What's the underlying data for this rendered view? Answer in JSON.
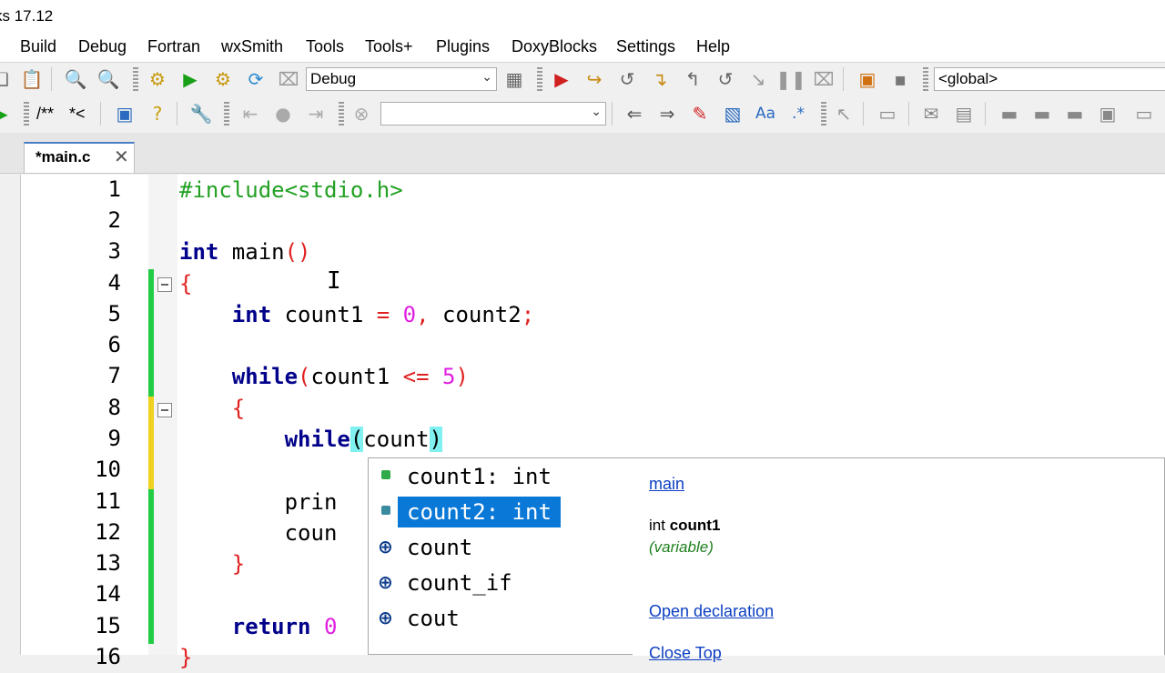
{
  "window": {
    "title": "ks 17.12"
  },
  "menu": [
    "Build",
    "Debug",
    "Fortran",
    "wxSmith",
    "Tools",
    "Tools+",
    "Plugins",
    "DoxyBlocks",
    "Settings",
    "Help"
  ],
  "toolbar1": {
    "build_target": "Debug",
    "scope": "<global>"
  },
  "toolbar2": {
    "comment_block": "/**",
    "comment_line": "*<",
    "search_value": ""
  },
  "editor": {
    "tab_label": "*main.c",
    "line_numbers": [
      "1",
      "2",
      "3",
      "4",
      "5",
      "6",
      "7",
      "8",
      "9",
      "10",
      "11",
      "12",
      "13",
      "14",
      "15",
      "16"
    ],
    "lines": [
      "#include<stdio.h>",
      "",
      "int main()",
      "{",
      "    int count1 = 0, count2;",
      "",
      "    while(count1 <= 5)",
      "    {",
      "        while(count)",
      "",
      "        prin",
      "        coun",
      "    }",
      "",
      "    return 0",
      "}"
    ]
  },
  "autocomplete": {
    "items": [
      {
        "label": "count1: int",
        "icon": "variable-icon",
        "selected": false
      },
      {
        "label": "count2: int",
        "icon": "variable-icon",
        "selected": true
      },
      {
        "label": "count",
        "icon": "cpp-symbol-icon",
        "selected": false
      },
      {
        "label": "count_if",
        "icon": "cpp-symbol-icon",
        "selected": false
      },
      {
        "label": "cout",
        "icon": "cpp-symbol-icon",
        "selected": false
      }
    ],
    "doc": {
      "scope_link": "main",
      "signature_type": "int",
      "signature_name": "count1",
      "kind": "(variable)",
      "open_declaration": "Open declaration",
      "close_top": "Close Top"
    }
  },
  "colors": {
    "keyword": "#00008b",
    "preprocessor": "#22a022",
    "operator": "#e02020",
    "number": "#e020e0",
    "selection": "#0a78d7",
    "link": "#0b3ec2",
    "change_saved": "#22cc44",
    "change_unsaved": "#f0d020"
  }
}
